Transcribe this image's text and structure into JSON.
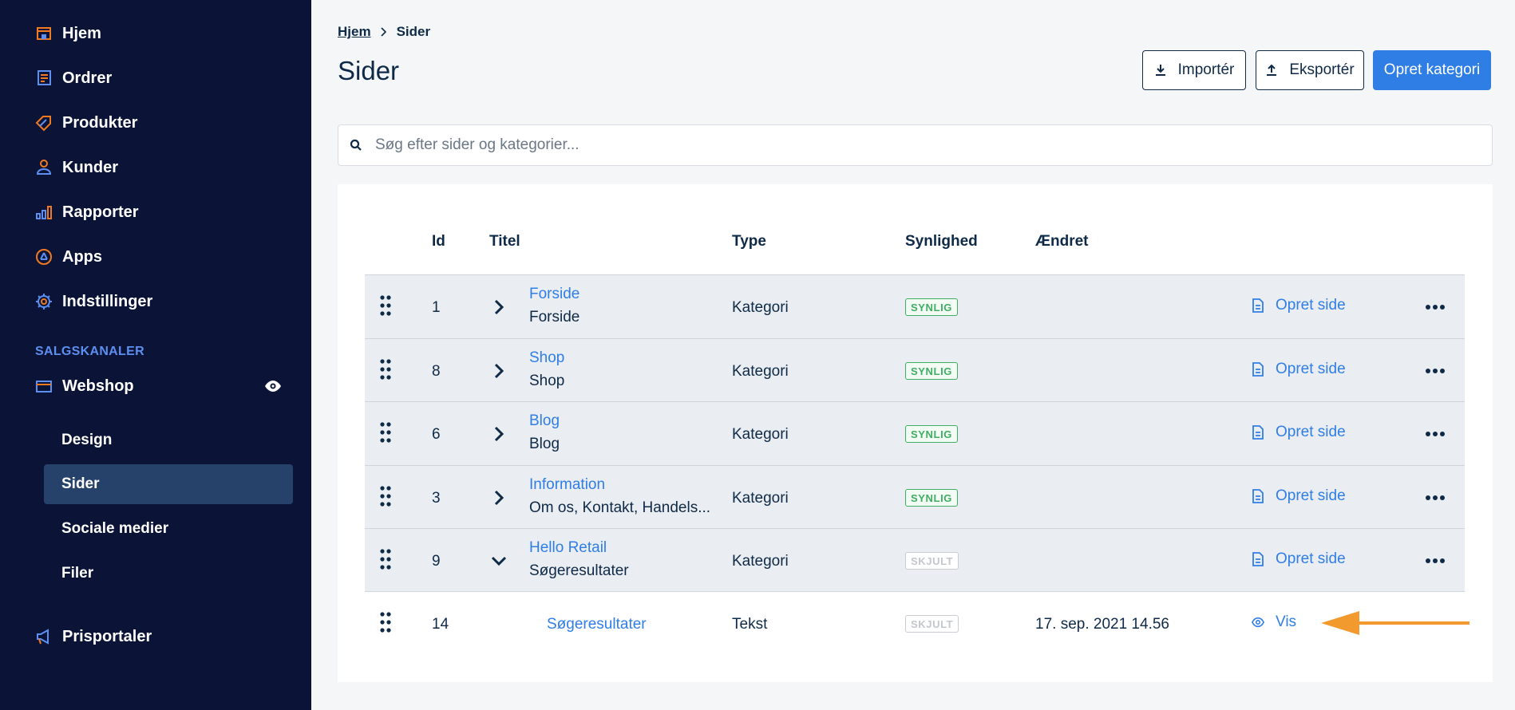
{
  "sidebar": {
    "nav": [
      {
        "label": "Hjem",
        "icon": "home-icon"
      },
      {
        "label": "Ordrer",
        "icon": "orders-icon"
      },
      {
        "label": "Produkter",
        "icon": "tag-icon"
      },
      {
        "label": "Kunder",
        "icon": "user-icon"
      },
      {
        "label": "Rapporter",
        "icon": "bar-chart-icon"
      },
      {
        "label": "Apps",
        "icon": "apps-icon"
      },
      {
        "label": "Indstillinger",
        "icon": "gear-icon"
      }
    ],
    "section_label": "SALGSKANALER",
    "webshop_label": "Webshop",
    "sub_items": [
      "Design",
      "Sider",
      "Sociale medier",
      "Filer"
    ],
    "active_sub_item": "Sider",
    "prisportaler_label": "Prisportaler"
  },
  "breadcrumb": {
    "home": "Hjem",
    "current": "Sider"
  },
  "page_title": "Sider",
  "buttons": {
    "import": "Importér",
    "export": "Eksportér",
    "create_category": "Opret kategori"
  },
  "search": {
    "placeholder": "Søg efter sider og kategorier..."
  },
  "table": {
    "headers": {
      "id": "Id",
      "title": "Titel",
      "type": "Type",
      "visibility": "Synlighed",
      "changed": "Ændret"
    },
    "rows": [
      {
        "id": "1",
        "title": "Forside",
        "subtitle": "Forside",
        "type": "Kategori",
        "visibility": "SYNLIG",
        "changed": "",
        "action": "Opret side"
      },
      {
        "id": "8",
        "title": "Shop",
        "subtitle": "Shop",
        "type": "Kategori",
        "visibility": "SYNLIG",
        "changed": "",
        "action": "Opret side"
      },
      {
        "id": "6",
        "title": "Blog",
        "subtitle": "Blog",
        "type": "Kategori",
        "visibility": "SYNLIG",
        "changed": "",
        "action": "Opret side"
      },
      {
        "id": "3",
        "title": "Information",
        "subtitle": "Om os, Kontakt, Handels...",
        "type": "Kategori",
        "visibility": "SYNLIG",
        "changed": "",
        "action": "Opret side"
      },
      {
        "id": "9",
        "title": "Hello Retail",
        "subtitle": "Søgeresultater",
        "type": "Kategori",
        "visibility": "SKJULT",
        "changed": "",
        "action": "Opret side"
      },
      {
        "id": "14",
        "title": "Søgeresultater",
        "subtitle": "",
        "type": "Tekst",
        "visibility": "SKJULT",
        "changed": "17. sep. 2021 14.56",
        "action": "Vis"
      }
    ]
  },
  "colors": {
    "sidebar_bg": "#0b1437",
    "accent": "#2f7ee6",
    "icon_orange": "#f07a22",
    "annotation_arrow": "#f39a2e",
    "visible_green": "#3fae62"
  }
}
